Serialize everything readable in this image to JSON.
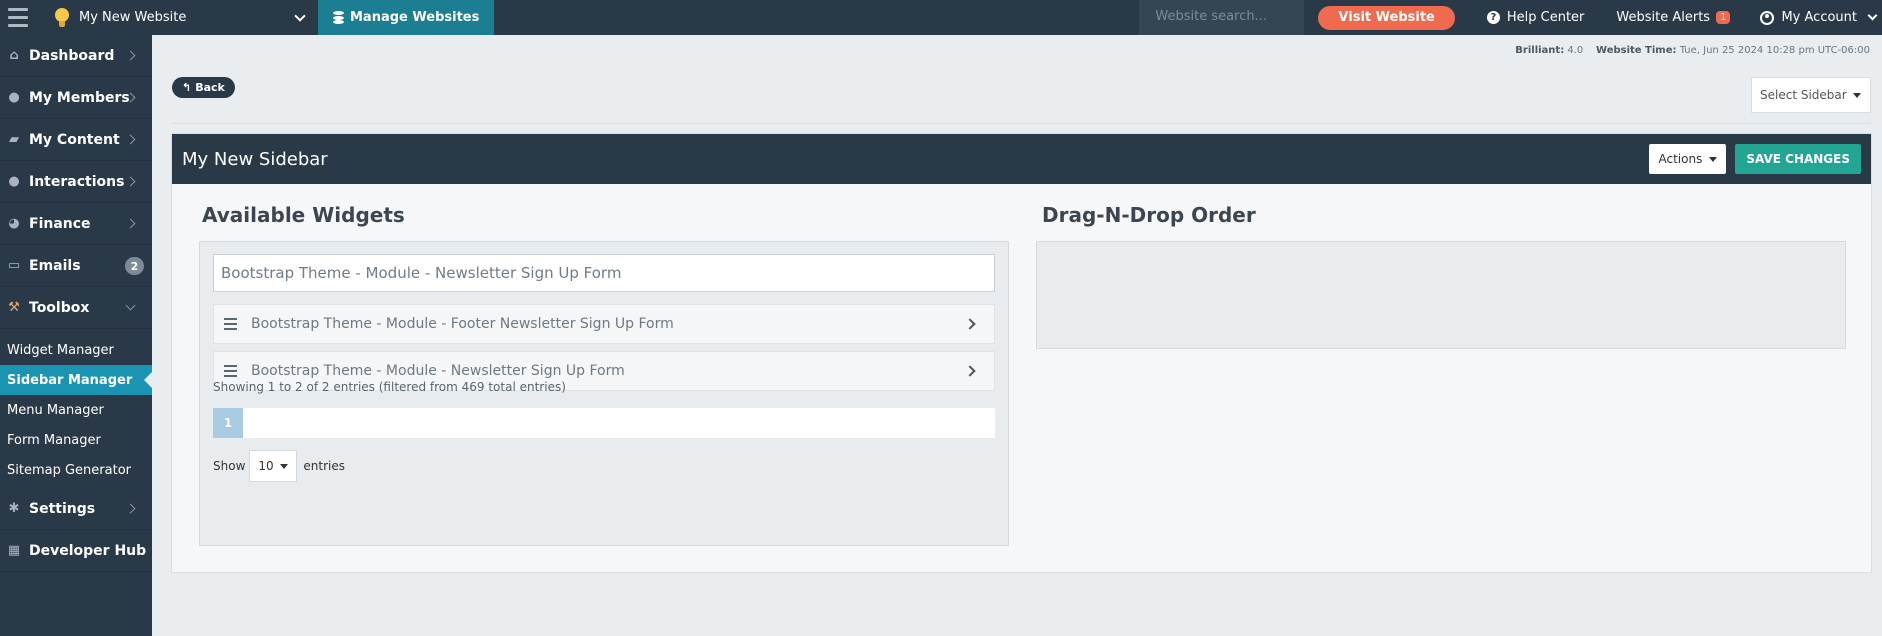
{
  "topbar": {
    "site_name": "My New Website",
    "manage_label": "Manage Websites",
    "search_placeholder": "Website search...",
    "visit_label": "Visit Website",
    "help_label": "Help Center",
    "alerts_label": "Website Alerts",
    "alerts_count": "1",
    "account_label": "My Account"
  },
  "sidebar": {
    "items": [
      {
        "label": "Dashboard",
        "icon": "home-icon"
      },
      {
        "label": "My Members",
        "icon": "users-icon"
      },
      {
        "label": "My Content",
        "icon": "folder-icon"
      },
      {
        "label": "Interactions",
        "icon": "chat-icon"
      },
      {
        "label": "Finance",
        "icon": "pie-chart-icon"
      },
      {
        "label": "Emails",
        "icon": "inbox-icon",
        "badge": "2"
      },
      {
        "label": "Toolbox",
        "icon": "wrench-icon"
      },
      {
        "label": "Settings",
        "icon": "gear-icon"
      },
      {
        "label": "Developer Hub",
        "icon": "grid-icon"
      }
    ],
    "toolbox_sub": [
      "Widget Manager",
      "Sidebar Manager",
      "Menu Manager",
      "Form Manager",
      "Sitemap Generator"
    ]
  },
  "meta": {
    "brilliant_label": "Brilliant:",
    "brilliant_value": "4.0",
    "time_label": "Website Time:",
    "time_value": "Tue, Jun 25 2024 10:28 pm UTC-06:00"
  },
  "back_label": "Back",
  "select_sidebar_label": "Select Sidebar",
  "panel": {
    "title": "My New Sidebar",
    "actions_label": "Actions",
    "save_label": "SAVE CHANGES",
    "available_title": "Available Widgets",
    "order_title": "Drag-N-Drop Order",
    "filter_value": "Bootstrap Theme - Module - Newsletter Sign Up Form",
    "widgets": [
      "Bootstrap Theme - Module - Footer Newsletter Sign Up Form",
      "Bootstrap Theme - Module - Newsletter Sign Up Form"
    ],
    "info_text": "Showing 1 to 2 of 2 entries (filtered from 469 total entries)",
    "current_page": "1",
    "show_label": "Show",
    "page_length": "10",
    "entries_label": "entries"
  },
  "colors": {
    "navy": "#2a3947",
    "teal": "#1c7e92",
    "active_blue": "#1b94b3",
    "orange": "#f06a4f",
    "save_green": "#23a593"
  }
}
